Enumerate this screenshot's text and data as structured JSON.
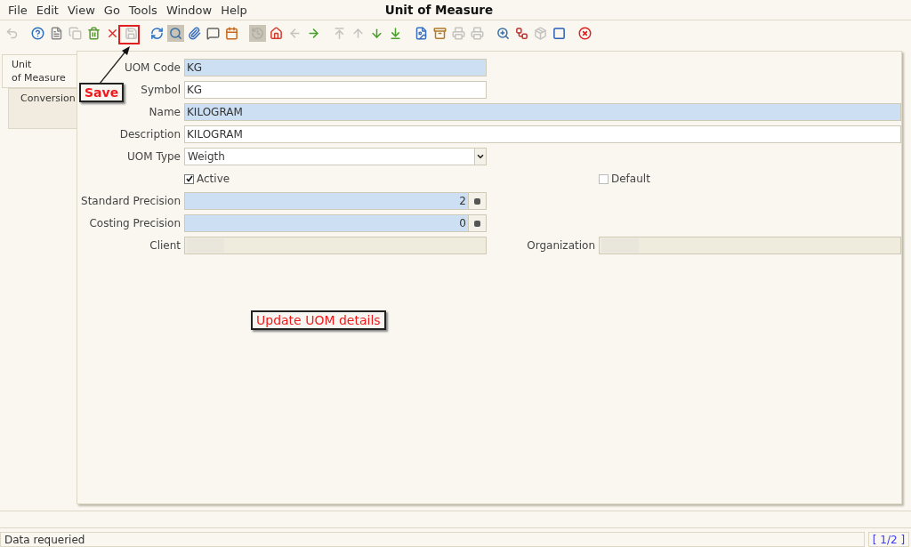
{
  "menu": [
    {
      "label": "File"
    },
    {
      "label": "Edit"
    },
    {
      "label": "View"
    },
    {
      "label": "Go"
    },
    {
      "label": "Tools"
    },
    {
      "label": "Window"
    },
    {
      "label": "Help"
    }
  ],
  "window": {
    "title": "Unit of Measure"
  },
  "toolbar": [
    {
      "disabled": true,
      "pressed": false
    },
    {
      "disabled": false,
      "pressed": false
    },
    {
      "disabled": false,
      "pressed": false
    },
    {
      "disabled": true,
      "pressed": false
    },
    {
      "disabled": false,
      "pressed": false
    },
    {
      "disabled": false,
      "pressed": false
    },
    {
      "disabled": true,
      "pressed": false
    },
    {
      "disabled": false,
      "pressed": false
    },
    {
      "disabled": false,
      "pressed": true
    },
    {
      "disabled": false,
      "pressed": false
    },
    {
      "disabled": false,
      "pressed": false
    },
    {
      "disabled": false,
      "pressed": false
    },
    {
      "disabled": true,
      "pressed": true
    },
    {
      "disabled": false,
      "pressed": false
    },
    {
      "disabled": true,
      "pressed": false
    },
    {
      "disabled": false,
      "pressed": false
    },
    {
      "disabled": true,
      "pressed": false
    },
    {
      "disabled": true,
      "pressed": false
    },
    {
      "disabled": false,
      "pressed": false
    },
    {
      "disabled": false,
      "pressed": false
    },
    {
      "disabled": false,
      "pressed": false
    },
    {
      "disabled": false,
      "pressed": false
    },
    {
      "disabled": true,
      "pressed": false
    },
    {
      "disabled": true,
      "pressed": false
    },
    {
      "disabled": false,
      "pressed": false
    },
    {
      "disabled": false,
      "pressed": false
    },
    {
      "disabled": true,
      "pressed": false
    },
    {
      "disabled": false,
      "pressed": false
    },
    {
      "disabled": false,
      "pressed": false
    }
  ],
  "tabs": [
    {
      "label": "Unit\nof Measure",
      "selected": true
    },
    {
      "label": "Conversion",
      "selected": false
    }
  ],
  "rows": [
    [
      {
        "kind": "text",
        "label": "UOM Code",
        "value": "KG",
        "mandatory": true
      }
    ],
    [
      {
        "kind": "text",
        "label": "Symbol",
        "value": "KG",
        "mandatory": false
      }
    ],
    [
      {
        "kind": "longtext",
        "label": "Name",
        "value": "KILOGRAM",
        "mandatory": true
      }
    ],
    [
      {
        "kind": "longtext",
        "label": "Description",
        "value": "KILOGRAM",
        "mandatory": false
      }
    ],
    [
      {
        "kind": "select",
        "label": "UOM Type",
        "value": "Weigth",
        "mandatory": false
      }
    ],
    [
      {
        "kind": "checkbox",
        "label": "Active",
        "checked": true
      },
      {
        "kind": "checkbox",
        "label": "Default",
        "checked": false
      }
    ],
    [
      {
        "kind": "number",
        "label": "Standard Precision",
        "value": "2",
        "mandatory": true
      }
    ],
    [
      {
        "kind": "number",
        "label": "Costing Precision",
        "value": "0",
        "mandatory": true
      }
    ],
    [
      {
        "kind": "text",
        "label": "Client",
        "readonly": true
      },
      {
        "kind": "text",
        "label": "Organization",
        "readonly": true
      }
    ]
  ],
  "annotations": [
    {
      "text": "Save"
    },
    {
      "text": "Update UOM details"
    }
  ],
  "status_bar": {
    "message": "Data requeried",
    "record": "[ 1/2 ]"
  }
}
